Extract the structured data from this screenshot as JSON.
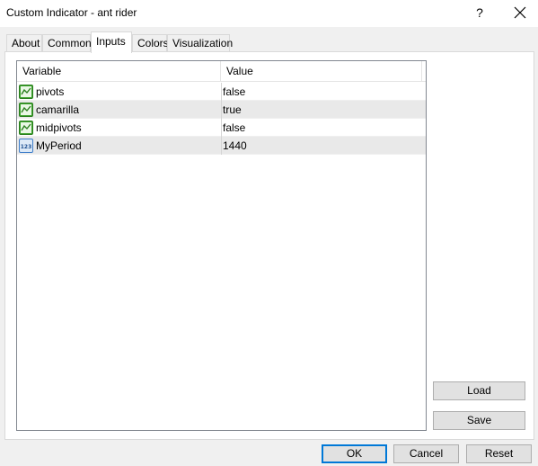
{
  "window": {
    "title": "Custom Indicator - ant rider",
    "help_label": "?"
  },
  "tabs": [
    {
      "label": "About"
    },
    {
      "label": "Common"
    },
    {
      "label": "Inputs",
      "active": true
    },
    {
      "label": "Colors"
    },
    {
      "label": "Visualization"
    }
  ],
  "grid": {
    "columns": {
      "variable": "Variable",
      "value": "Value"
    },
    "rows": [
      {
        "name": "pivots",
        "value": "false",
        "icon": "boolean-chart-icon"
      },
      {
        "name": "camarilla",
        "value": "true",
        "icon": "boolean-chart-icon"
      },
      {
        "name": "midpivots",
        "value": "false",
        "icon": "boolean-chart-icon"
      },
      {
        "name": "MyPeriod",
        "value": "1440",
        "icon": "integer-123-icon"
      }
    ]
  },
  "side_buttons": {
    "load": "Load",
    "save": "Save"
  },
  "footer_buttons": {
    "ok": "OK",
    "cancel": "Cancel",
    "reset": "Reset"
  },
  "colors": {
    "accent": "#0078d7",
    "icon_green": "#3fa52f",
    "icon_blue": "#3f7ec9"
  }
}
